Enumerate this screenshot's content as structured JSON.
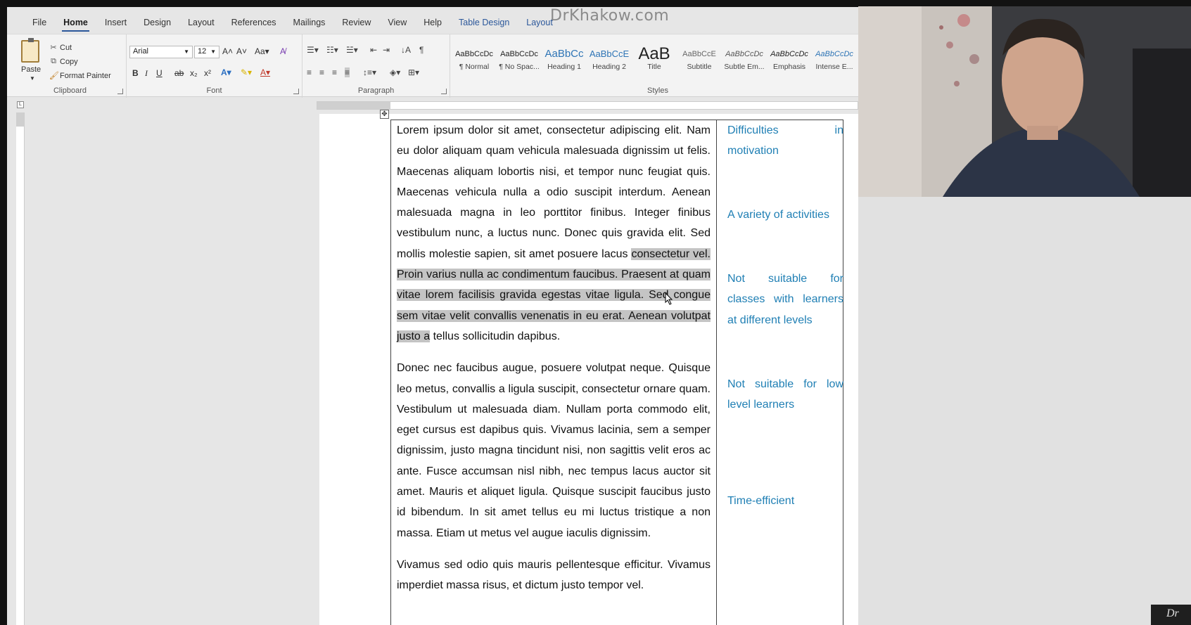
{
  "window": {
    "watermark": "DrKhakow.com"
  },
  "menu": {
    "tabs": [
      "File",
      "Home",
      "Insert",
      "Design",
      "Layout",
      "References",
      "Mailings",
      "Review",
      "View",
      "Help",
      "Table Design",
      "Layout"
    ],
    "active_tab": "Home"
  },
  "ribbon": {
    "clipboard": {
      "paste": "Paste",
      "cut": "Cut",
      "copy": "Copy",
      "format_painter": "Format Painter",
      "label": "Clipboard"
    },
    "font": {
      "font_name": "Arial",
      "font_size": "12",
      "label": "Font"
    },
    "paragraph": {
      "label": "Paragraph"
    },
    "styles": {
      "label": "Styles",
      "items": [
        {
          "sample": "AaBbCcDc",
          "name": "¶ Normal"
        },
        {
          "sample": "AaBbCcDc",
          "name": "¶ No Spac..."
        },
        {
          "sample": "AaBbCc",
          "name": "Heading 1"
        },
        {
          "sample": "AaBbCcE",
          "name": "Heading 2"
        },
        {
          "sample": "AaB",
          "name": "Title"
        },
        {
          "sample": "AaBbCcE",
          "name": "Subtitle"
        },
        {
          "sample": "AaBbCcDc",
          "name": "Subtle Em..."
        },
        {
          "sample": "AaBbCcDc",
          "name": "Emphasis"
        },
        {
          "sample": "AaBbCcDc",
          "name": "Intense E..."
        }
      ]
    }
  },
  "document": {
    "para1_before": "Lorem ipsum dolor sit amet, consectetur adipiscing elit. Nam eu dolor aliquam quam vehicula malesuada dignissim ut felis. Maecenas aliquam lobortis nisi, et tempor nunc feugiat quis. Maecenas vehicula nulla a odio suscipit interdum. Aenean malesuada magna in leo porttitor finibus. Integer finibus vestibulum nunc, a luctus nunc. Donec quis gravida elit. Sed mollis molestie sapien, sit amet posuere lacus ",
    "para1_selected": "consectetur vel. Proin varius nulla ac condimentum faucibus. Praesent at quam vitae lorem facilisis gravida egestas vitae ligula. Sed congue sem vitae velit convallis venenatis in eu erat. Aenean volutpat justo a",
    "para1_after": " tellus sollicitudin dapibus.",
    "para2": "Donec nec faucibus augue, posuere volutpat neque. Quisque leo metus, convallis a ligula suscipit, consectetur ornare quam. Vestibulum ut malesuada diam. Nullam porta commodo elit, eget cursus est dapibus quis. Vivamus lacinia, sem a semper dignissim, justo magna tincidunt nisi, non sagittis velit eros ac ante. Fusce accumsan nisl nibh, nec tempus lacus auctor sit amet. Mauris et aliquet ligula. Quisque suscipit faucibus justo id bibendum. In sit amet tellus eu mi luctus tristique a non massa. Etiam ut metus vel augue iaculis dignissim.",
    "para3": "Vivamus sed odio quis mauris pellentesque efficitur. Vivamus imperdiet massa risus, et dictum justo tempor vel.",
    "side_notes": [
      "Difficulties in motivation",
      "A variety of activities",
      "Not suitable for classes with learners at different levels",
      "Not suitable for low level learners",
      "Time-efficient"
    ]
  },
  "badge": "Dr"
}
